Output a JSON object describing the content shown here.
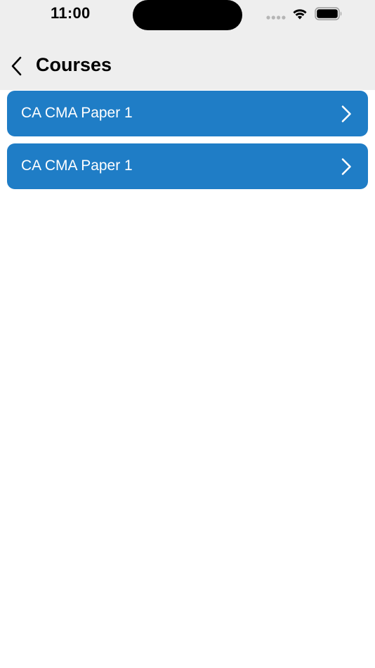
{
  "status_bar": {
    "time": "11:00"
  },
  "nav": {
    "back_icon": "chevron-left-icon",
    "title": "Courses"
  },
  "courses": [
    {
      "label": "CA CMA Paper 1",
      "icon": "chevron-right-icon"
    },
    {
      "label": "CA CMA Paper 1",
      "icon": "chevron-right-icon"
    }
  ],
  "colors": {
    "header_bg": "#eeeeee",
    "card_bg": "#1f7dc6",
    "card_text": "#ffffff",
    "page_bg": "#ffffff"
  }
}
